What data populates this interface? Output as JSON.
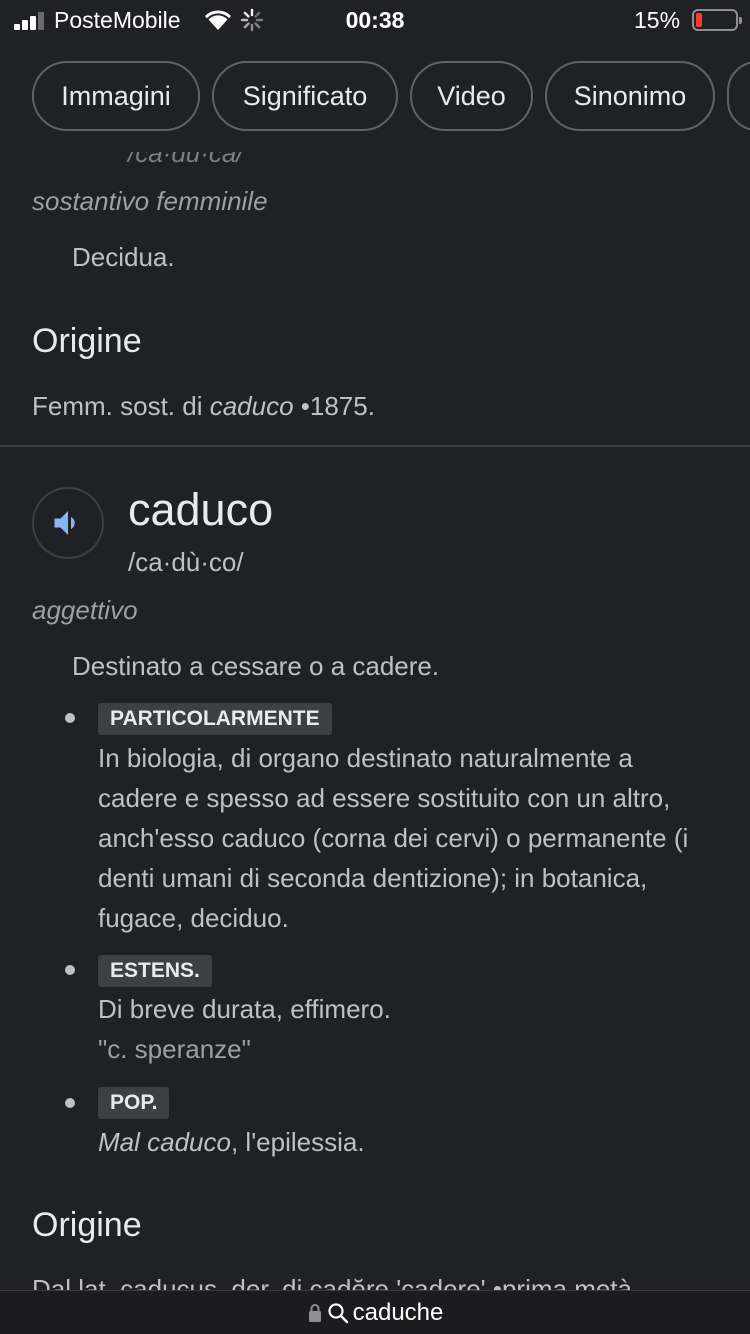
{
  "status_bar": {
    "carrier": "PosteMobile",
    "time": "00:38",
    "battery_percent": "15%",
    "battery_level": 0.15,
    "battery_color": "#ff3b30"
  },
  "chips": [
    {
      "label": "Immagini"
    },
    {
      "label": "Significato"
    },
    {
      "label": "Video"
    },
    {
      "label": "Sinonimo"
    }
  ],
  "entry_prev": {
    "pronunciation_partial": "/ca·du·ca/",
    "pos": "sostantivo femminile",
    "definition": "Decidua.",
    "origin_heading": "Origine",
    "origin_prefix": "Femm. sost. di ",
    "origin_word": "caduco",
    "origin_suffix": " •1875."
  },
  "entry": {
    "word": "caduco",
    "pronunciation": "/ca·dù·co/",
    "pos": "aggettivo",
    "definition": "Destinato a cessare o a cadere.",
    "senses": [
      {
        "tag": "PARTICOLARMENTE",
        "text": "In biologia, di organo destinato naturalmente a cadere e spesso ad essere sostituito con un altro, anch'esso caduco (corna dei cervi) o permanente (i denti umani di seconda dentizione); in botanica, fugace, deciduo."
      },
      {
        "tag": "ESTENS.",
        "text": "Di breve durata, effimero.",
        "example": "\"c. speranze\""
      },
      {
        "tag": "POP.",
        "text_italic": "Mal caduco",
        "text_rest": ", l'epilessia."
      }
    ],
    "origin_heading": "Origine",
    "origin_partial": "Dal lat. caducus, der. di cadĕre 'cadere' •prima metà"
  },
  "url_bar": {
    "text": "caduche",
    "lock_icon": "lock-icon",
    "search_icon": "search-icon"
  },
  "colors": {
    "background": "#202124",
    "accent_speaker": "#8ab4f8"
  }
}
